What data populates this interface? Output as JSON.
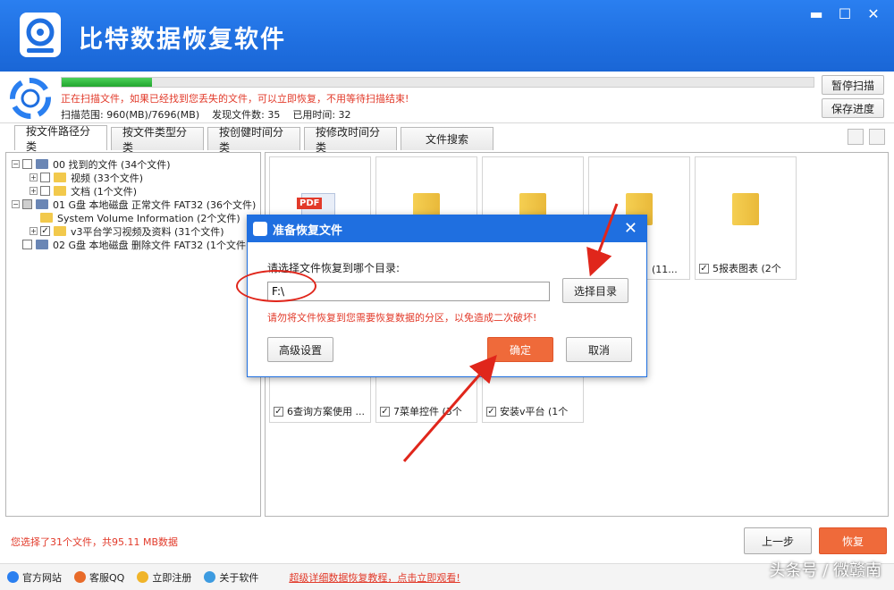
{
  "app": {
    "title": "比特数据恢复软件",
    "window_buttons": [
      "minimize",
      "maximize",
      "close"
    ]
  },
  "scan": {
    "progress": 0.12,
    "warning": "正在扫描文件，如果已经找到您丢失的文件，可以立即恢复，不用等待扫描结束!",
    "range_label": "扫描范围: 960(MB)/7696(MB)",
    "found_label": "发现文件数: 35",
    "time_label": "已用时间: 32",
    "pause_button": "暂停扫描",
    "save_button": "保存进度"
  },
  "tabs": [
    {
      "label": "按文件路径分类",
      "active": true
    },
    {
      "label": "按文件类型分类",
      "active": false
    },
    {
      "label": "按创健时间分类",
      "active": false
    },
    {
      "label": "按修改时间分类",
      "active": false
    },
    {
      "label": "文件搜索",
      "active": false
    }
  ],
  "tree": [
    {
      "label": "00 找到的文件 (34个文件)",
      "level": 0,
      "type": "drive",
      "check": "none",
      "expand": "-"
    },
    {
      "label": "视频   (33个文件)",
      "level": 1,
      "type": "folder",
      "check": "none",
      "expand": "+"
    },
    {
      "label": "文档   (1个文件)",
      "level": 1,
      "type": "folder",
      "check": "none",
      "expand": "+"
    },
    {
      "label": "01 G盘 本地磁盘 正常文件 FAT32 (36个文件)",
      "level": 0,
      "type": "drive",
      "check": "partial",
      "expand": "-"
    },
    {
      "label": "System Volume Information   (2个文件)",
      "level": 1,
      "type": "folder",
      "check": "none",
      "expand": ""
    },
    {
      "label": "v3平台学习视频及资料   (31个文件)",
      "level": 1,
      "type": "folder",
      "check": "checked",
      "expand": "+"
    },
    {
      "label": "02 G盘 本地磁盘 删除文件 FAT32 (1个文件)",
      "level": 0,
      "type": "drive",
      "check": "none",
      "expand": ""
    }
  ],
  "files_top": [
    {
      "type": "pdf",
      "pdf_label": "PDF",
      "caption": ""
    },
    {
      "type": "folder",
      "caption": ""
    },
    {
      "type": "folder",
      "caption": ""
    },
    {
      "type": "folder",
      "caption": "(11..."
    },
    {
      "type": "folder",
      "caption": "5报表图表 (2个"
    }
  ],
  "files_bottom": [
    {
      "caption": "6查询方案使用 ..."
    },
    {
      "caption": "7菜单控件 (3个"
    },
    {
      "caption": "安装v平台 (1个"
    }
  ],
  "dialog": {
    "title": "准备恢复文件",
    "prompt": "请选择文件恢复到哪个目录:",
    "path_value": "F:\\",
    "browse_button": "选择目录",
    "warning": "请勿将文件恢复到您需要恢复数据的分区，以免造成二次破坏!",
    "advanced_button": "高级设置",
    "ok_button": "确定",
    "cancel_button": "取消"
  },
  "bottom": {
    "selected_info": "您选择了31个文件，共95.11 MB数据",
    "prev_button": "上一步",
    "recover_button": "恢复"
  },
  "footer": {
    "links": [
      "官方网站",
      "客服QQ",
      "立即注册",
      "关于软件"
    ],
    "tutorial_link": "超级详细数据恢复教程，点击立即观看!",
    "watermark": "头条号 / 微赣南"
  },
  "colors": {
    "title_blue": "#1f6fe0",
    "accent_orange": "#ef6a3a",
    "warning_red": "#e23a2a",
    "progress_green": "#23a52f"
  }
}
